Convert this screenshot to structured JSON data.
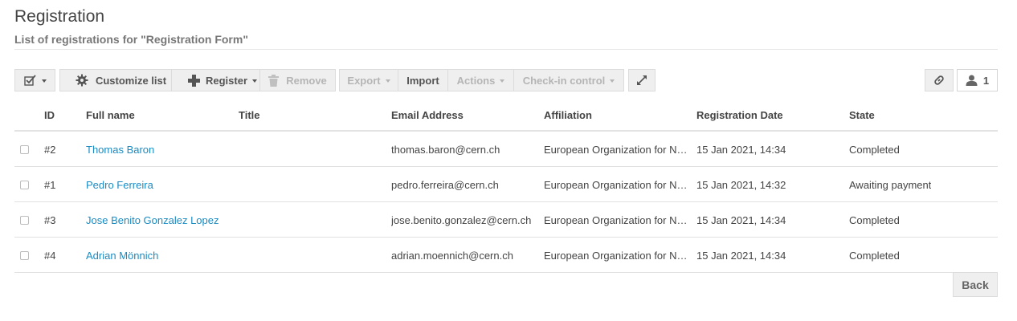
{
  "header": {
    "title": "Registration",
    "subtitle": "List of registrations for \"Registration Form\""
  },
  "toolbar": {
    "select_icon": "checkbox-select-icon",
    "customize_label": "Customize list",
    "customize_icon": "gear-icon",
    "register_label": "Register",
    "register_icon": "plus-icon",
    "remove_label": "Remove",
    "remove_icon": "trash-icon",
    "export_label": "Export",
    "import_label": "Import",
    "actions_label": "Actions",
    "checkin_label": "Check-in control",
    "expand_icon": "expand-icon",
    "link_icon": "link-icon",
    "user_icon": "user-icon",
    "user_count": "1"
  },
  "table": {
    "columns": [
      "ID",
      "Full name",
      "Title",
      "Email Address",
      "Affiliation",
      "Registration Date",
      "State"
    ],
    "rows": [
      {
        "id": "#2",
        "name": "Thomas Baron",
        "title": "",
        "email": "thomas.baron@cern.ch",
        "affiliation": "European Organization for Nuclear Research",
        "date": "15 Jan 2021, 14:34",
        "state": "Completed"
      },
      {
        "id": "#1",
        "name": "Pedro Ferreira",
        "title": "",
        "email": "pedro.ferreira@cern.ch",
        "affiliation": "European Organization for Nuclear Research",
        "date": "15 Jan 2021, 14:32",
        "state": "Awaiting payment"
      },
      {
        "id": "#3",
        "name": "Jose Benito Gonzalez Lopez",
        "title": "",
        "email": "jose.benito.gonzalez@cern.ch",
        "affiliation": "European Organization for Nuclear Research",
        "date": "15 Jan 2021, 14:34",
        "state": "Completed"
      },
      {
        "id": "#4",
        "name": "Adrian Mönnich",
        "title": "",
        "email": "adrian.moennich@cern.ch",
        "affiliation": "European Organization for Nuclear Research",
        "date": "15 Jan 2021, 14:34",
        "state": "Completed"
      }
    ]
  },
  "footer": {
    "back_label": "Back"
  },
  "colors": {
    "link": "#1b8bc2",
    "toolbar_bg": "#efefef",
    "disabled_text": "#b5b5b5"
  }
}
